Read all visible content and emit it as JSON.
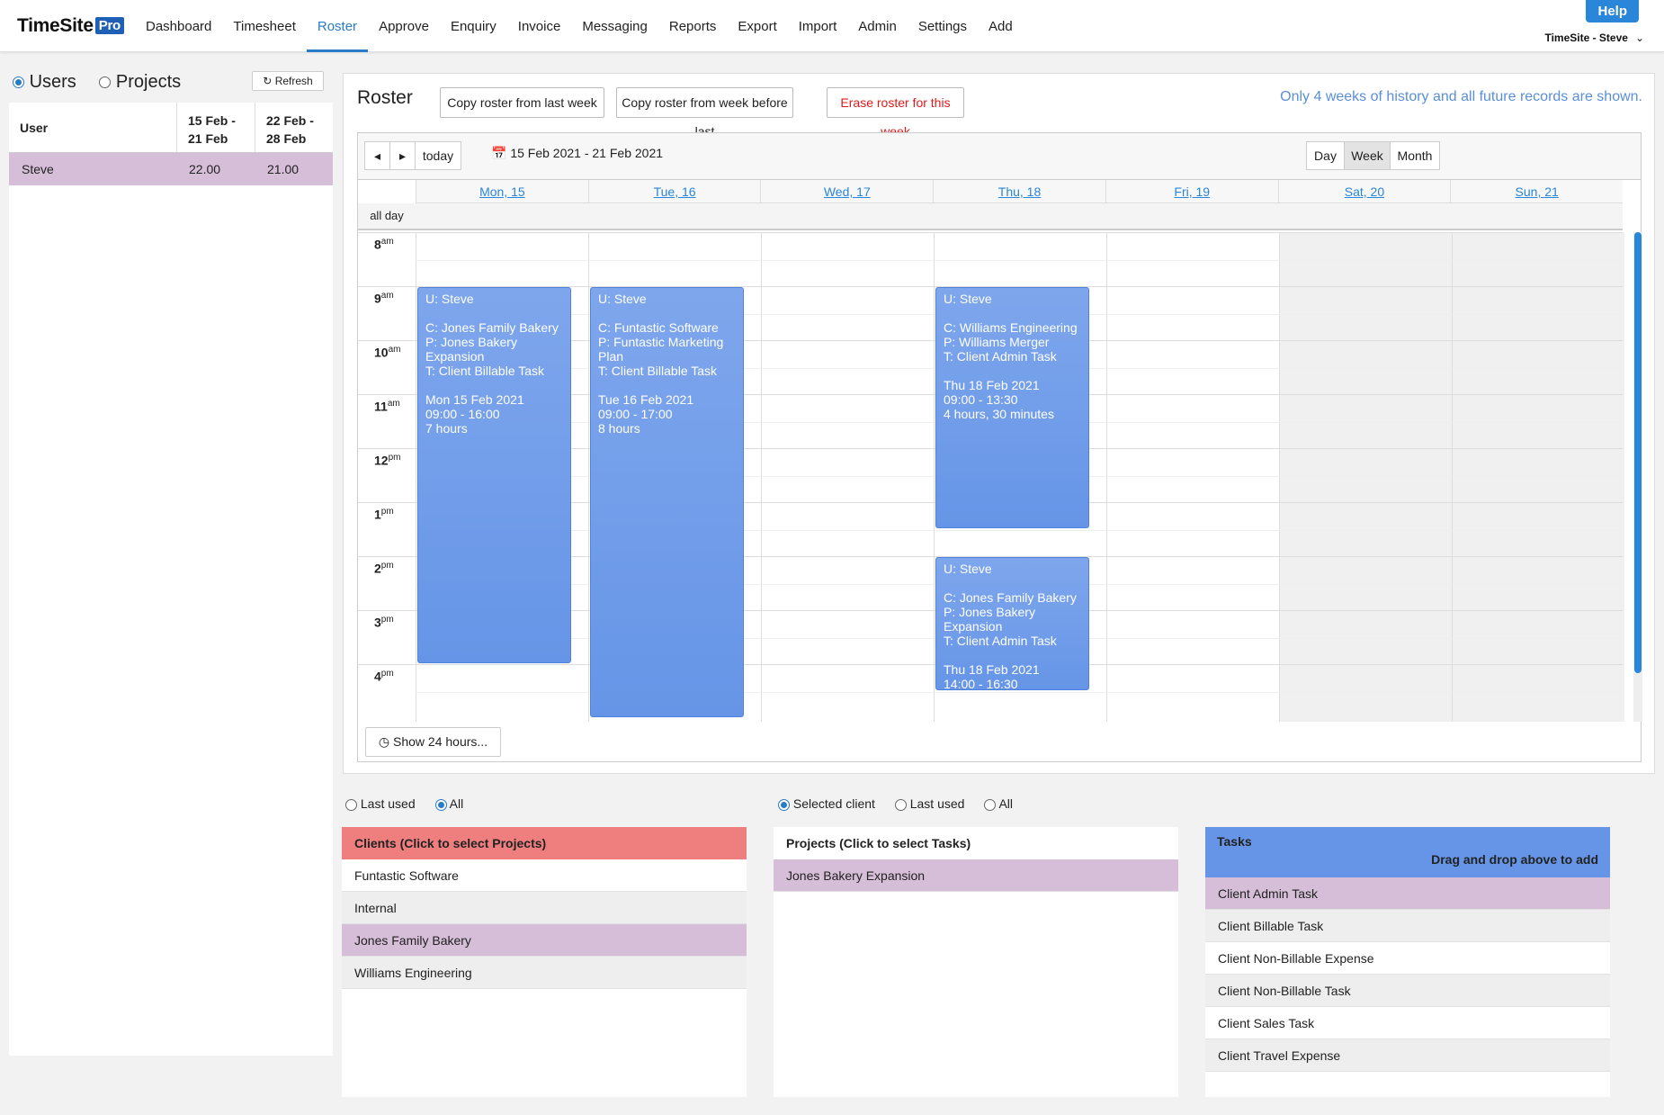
{
  "brand": {
    "name": "TimeSite",
    "badge": "Pro"
  },
  "nav": [
    "Dashboard",
    "Timesheet",
    "Roster",
    "Approve",
    "Enquiry",
    "Invoice",
    "Messaging",
    "Reports",
    "Export",
    "Import",
    "Admin",
    "Settings",
    "Add"
  ],
  "nav_active": "Roster",
  "help_label": "Help",
  "user_menu": "TimeSite - Steve",
  "left": {
    "radio_users": "Users",
    "radio_projects": "Projects",
    "refresh": "Refresh",
    "col_user": "User",
    "col_week1_a": "15 Feb -",
    "col_week1_b": "21 Feb",
    "col_week2_a": "22 Feb -",
    "col_week2_b": "28 Feb",
    "rows": [
      {
        "user": "Steve",
        "w1": "22.00",
        "w2": "21.00"
      }
    ]
  },
  "roster": {
    "title": "Roster",
    "copy_last": "Copy roster from last week",
    "copy_before": "Copy roster from week before last",
    "erase": "Erase roster for this week",
    "history_note": "Only 4 weeks of history and all future records are shown.",
    "today": "today",
    "date_range": "15 Feb 2021 - 21 Feb 2021",
    "view_day": "Day",
    "view_week": "Week",
    "view_month": "Month",
    "all_day": "all day",
    "days": [
      "Mon, 15",
      "Tue, 16",
      "Wed, 17",
      "Thu, 18",
      "Fri, 19",
      "Sat, 20",
      "Sun, 21"
    ],
    "hours": [
      {
        "h": "8",
        "ap": "am"
      },
      {
        "h": "9",
        "ap": "am"
      },
      {
        "h": "10",
        "ap": "am"
      },
      {
        "h": "11",
        "ap": "am"
      },
      {
        "h": "12",
        "ap": "pm"
      },
      {
        "h": "1",
        "ap": "pm"
      },
      {
        "h": "2",
        "ap": "pm"
      },
      {
        "h": "3",
        "ap": "pm"
      },
      {
        "h": "4",
        "ap": "pm"
      }
    ],
    "show_24": "Show 24 hours...",
    "events": [
      {
        "u": "U: Steve",
        "c": "C: Jones Family Bakery",
        "p": "P: Jones Bakery Expansion",
        "t": "T: Client Billable Task",
        "date": "Mon 15 Feb 2021",
        "time": "09:00 - 16:00",
        "dur": "7 hours"
      },
      {
        "u": "U: Steve",
        "c": "C: Funtastic Software",
        "p": "P: Funtastic Marketing Plan",
        "t": "T: Client Billable Task",
        "date": "Tue 16 Feb 2021",
        "time": "09:00 - 17:00",
        "dur": "8 hours"
      },
      {
        "u": "U: Steve",
        "c": "C: Williams Engineering",
        "p": "P: Williams Merger",
        "t": "T: Client Admin Task",
        "date": "Thu 18 Feb 2021",
        "time": "09:00 - 13:30",
        "dur": "4 hours, 30 minutes"
      },
      {
        "u": "U: Steve",
        "c": "C: Jones Family Bakery",
        "p": "P: Jones Bakery Expansion",
        "t": "T: Client Admin Task",
        "date": "Thu 18 Feb 2021",
        "time": "14:00 - 16:30",
        "dur": ""
      }
    ]
  },
  "clients": {
    "filter_last": "Last used",
    "filter_all": "All",
    "header": "Clients (Click to select Projects)",
    "items": [
      "Funtastic Software",
      "Internal",
      "Jones Family Bakery",
      "Williams Engineering"
    ]
  },
  "projects": {
    "filter_selected": "Selected client",
    "filter_last": "Last used",
    "filter_all": "All",
    "header": "Projects (Click to select Tasks)",
    "items": [
      "Jones Bakery Expansion"
    ]
  },
  "tasks": {
    "header": "Tasks",
    "hint": "Drag and drop above to add",
    "items": [
      "Client Admin Task",
      "Client Billable Task",
      "Client Non-Billable Expense",
      "Client Non-Billable Task",
      "Client Sales Task",
      "Client Travel Expense"
    ]
  },
  "colors": {
    "accent": "#2a86d8",
    "selected": "#d6bed9",
    "clients_head": "#ef7f7f",
    "tasks_head": "#6695e7",
    "event": "#6695e7"
  }
}
